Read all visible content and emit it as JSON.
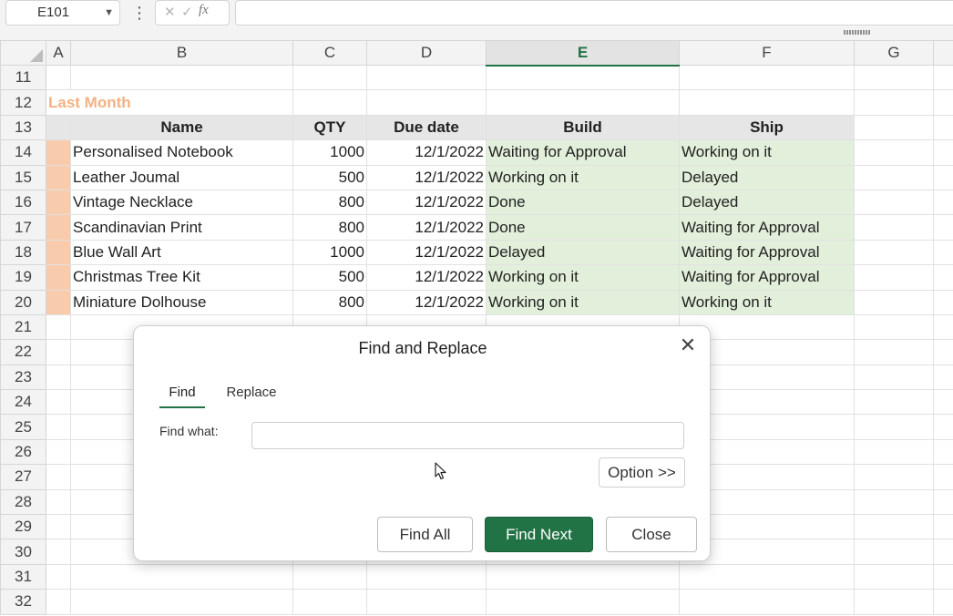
{
  "formula_bar": {
    "name_box": "E101",
    "cancel_glyph": "✕",
    "enter_glyph": "✓",
    "fx_label": "fx",
    "formula_value": ""
  },
  "columns": [
    "A",
    "B",
    "C",
    "D",
    "E",
    "F",
    "G",
    ""
  ],
  "selected_column": "E",
  "section_title": "Last Month",
  "table_headers": [
    "Name",
    "QTY",
    "Due date",
    "Build",
    "Ship"
  ],
  "rows": [
    {
      "row": "14",
      "name": "Personalised Notebook",
      "qty": "1000",
      "due": "12/1/2022",
      "build": "Waiting for Approval",
      "ship": "Working on it"
    },
    {
      "row": "15",
      "name": "Leather Joumal",
      "qty": "500",
      "due": "12/1/2022",
      "build": "Working on it",
      "ship": "Delayed"
    },
    {
      "row": "16",
      "name": "Vintage Necklace",
      "qty": "800",
      "due": "12/1/2022",
      "build": "Done",
      "ship": "Delayed"
    },
    {
      "row": "17",
      "name": "Scandinavian Print",
      "qty": "800",
      "due": "12/1/2022",
      "build": "Done",
      "ship": "Waiting for Approval"
    },
    {
      "row": "18",
      "name": "Blue Wall Art",
      "qty": "1000",
      "due": "12/1/2022",
      "build": "Delayed",
      "ship": "Waiting for Approval"
    },
    {
      "row": "19",
      "name": "Christmas Tree Kit",
      "qty": "500",
      "due": "12/1/2022",
      "build": "Working on it",
      "ship": "Waiting for Approval"
    },
    {
      "row": "20",
      "name": "Miniature Dolhouse",
      "qty": "800",
      "due": "12/1/2022",
      "build": "Working on it",
      "ship": "Working on it"
    }
  ],
  "row_numbers": [
    "11",
    "12",
    "13",
    "14",
    "15",
    "16",
    "17",
    "18",
    "19",
    "20",
    "21",
    "22",
    "23",
    "24",
    "25",
    "26",
    "27",
    "28",
    "29",
    "30",
    "31",
    "32"
  ],
  "colors": {
    "accent_green": "#217346",
    "status_fill": "#e2efda",
    "marker_fill": "#f8cbad",
    "title_orange": "#f4b183",
    "header_fill": "#e6e6e6"
  },
  "dialog": {
    "title": "Find and Replace",
    "close_glyph": "✕",
    "tabs": [
      {
        "label": "Find",
        "active": true
      },
      {
        "label": "Replace",
        "active": false
      }
    ],
    "find_what_label": "Find what:",
    "find_what_value": "",
    "option_button": "Option >>",
    "find_all_button": "Find All",
    "find_next_button": "Find Next",
    "close_button": "Close"
  }
}
